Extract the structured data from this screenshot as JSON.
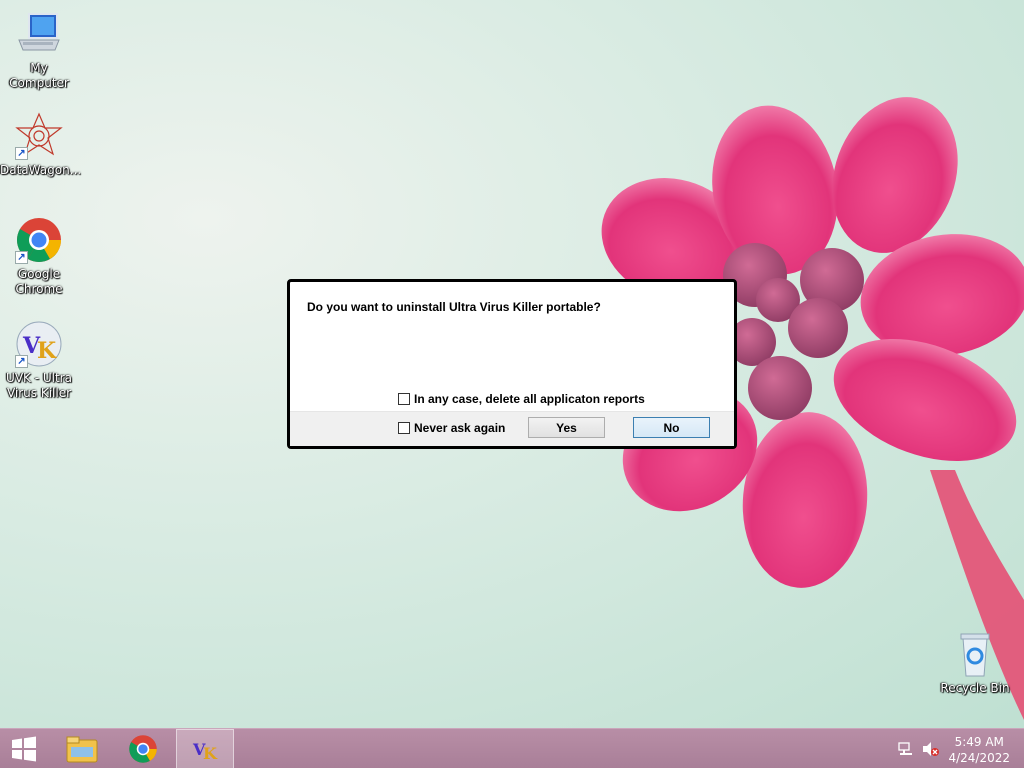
{
  "desktop": {
    "icons": [
      {
        "label": "My Computer",
        "icon": "computer-icon"
      },
      {
        "label": "DataWagon...",
        "icon": "datawagon-icon"
      },
      {
        "label": "Google Chrome",
        "icon": "chrome-icon"
      },
      {
        "label": "UVK - Ultra Virus Killer",
        "icon": "uvk-icon"
      },
      {
        "label": "Recycle Bin",
        "icon": "recycle-bin-icon"
      }
    ]
  },
  "dialog": {
    "question": "Do you want to uninstall Ultra Virus Killer portable?",
    "delete_reports_label": "In any case, delete all applicaton reports",
    "never_ask_label": "Never ask again",
    "yes_label": "Yes",
    "no_label": "No"
  },
  "taskbar": {
    "time": "5:49 AM",
    "date": "4/24/2022",
    "apps": [
      "start-icon",
      "file-explorer-icon",
      "chrome-icon",
      "uvk-icon"
    ]
  },
  "colors": {
    "taskbar": "#b88ea6",
    "flower": "#e8407f"
  }
}
